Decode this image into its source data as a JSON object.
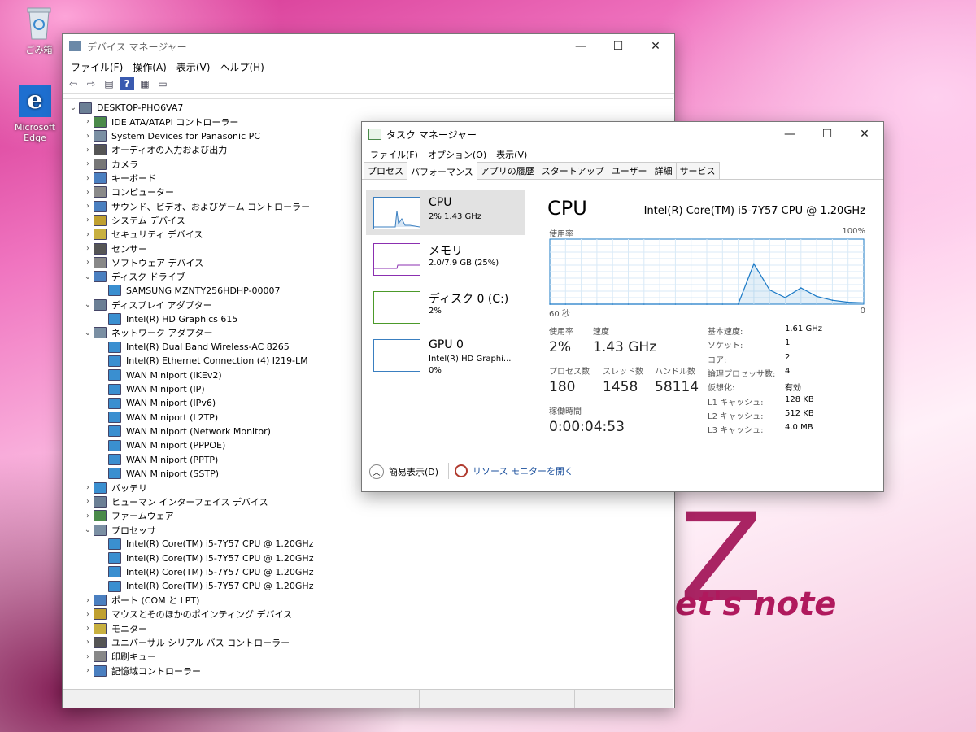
{
  "desktop": {
    "recycle_label": "ごみ箱",
    "edge_label": "Microsoft Edge",
    "brand_text": "et's note"
  },
  "devmgr": {
    "title": "デバイス マネージャー",
    "menu": [
      "ファイル(F)",
      "操作(A)",
      "表示(V)",
      "ヘルプ(H)"
    ],
    "tree": [
      {
        "label": "DESKTOP-PHO6VA7",
        "level": 0,
        "state": "expanded"
      },
      {
        "label": "IDE ATA/ATAPI コントローラー",
        "level": 1,
        "state": "collapsed"
      },
      {
        "label": "System Devices for Panasonic PC",
        "level": 1,
        "state": "collapsed"
      },
      {
        "label": "オーディオの入力および出力",
        "level": 1,
        "state": "collapsed"
      },
      {
        "label": "カメラ",
        "level": 1,
        "state": "collapsed"
      },
      {
        "label": "キーボード",
        "level": 1,
        "state": "collapsed"
      },
      {
        "label": "コンピューター",
        "level": 1,
        "state": "collapsed"
      },
      {
        "label": "サウンド、ビデオ、およびゲーム コントローラー",
        "level": 1,
        "state": "collapsed"
      },
      {
        "label": "システム デバイス",
        "level": 1,
        "state": "collapsed"
      },
      {
        "label": "セキュリティ デバイス",
        "level": 1,
        "state": "collapsed"
      },
      {
        "label": "センサー",
        "level": 1,
        "state": "collapsed"
      },
      {
        "label": "ソフトウェア デバイス",
        "level": 1,
        "state": "collapsed"
      },
      {
        "label": "ディスク ドライブ",
        "level": 1,
        "state": "expanded"
      },
      {
        "label": "SAMSUNG MZNTY256HDHP-00007",
        "level": 2,
        "state": "leaf"
      },
      {
        "label": "ディスプレイ アダプター",
        "level": 1,
        "state": "expanded"
      },
      {
        "label": "Intel(R) HD Graphics 615",
        "level": 2,
        "state": "leaf"
      },
      {
        "label": "ネットワーク アダプター",
        "level": 1,
        "state": "expanded"
      },
      {
        "label": "Intel(R) Dual Band Wireless-AC 8265",
        "level": 2,
        "state": "leaf"
      },
      {
        "label": "Intel(R) Ethernet Connection (4) I219-LM",
        "level": 2,
        "state": "leaf"
      },
      {
        "label": "WAN Miniport (IKEv2)",
        "level": 2,
        "state": "leaf"
      },
      {
        "label": "WAN Miniport (IP)",
        "level": 2,
        "state": "leaf"
      },
      {
        "label": "WAN Miniport (IPv6)",
        "level": 2,
        "state": "leaf"
      },
      {
        "label": "WAN Miniport (L2TP)",
        "level": 2,
        "state": "leaf"
      },
      {
        "label": "WAN Miniport (Network Monitor)",
        "level": 2,
        "state": "leaf"
      },
      {
        "label": "WAN Miniport (PPPOE)",
        "level": 2,
        "state": "leaf"
      },
      {
        "label": "WAN Miniport (PPTP)",
        "level": 2,
        "state": "leaf"
      },
      {
        "label": "WAN Miniport (SSTP)",
        "level": 2,
        "state": "leaf"
      },
      {
        "label": "バッテリ",
        "level": 1,
        "state": "collapsed"
      },
      {
        "label": "ヒューマン インターフェイス デバイス",
        "level": 1,
        "state": "collapsed"
      },
      {
        "label": "ファームウェア",
        "level": 1,
        "state": "collapsed"
      },
      {
        "label": "プロセッサ",
        "level": 1,
        "state": "expanded"
      },
      {
        "label": "Intel(R) Core(TM) i5-7Y57 CPU @ 1.20GHz",
        "level": 2,
        "state": "leaf"
      },
      {
        "label": "Intel(R) Core(TM) i5-7Y57 CPU @ 1.20GHz",
        "level": 2,
        "state": "leaf"
      },
      {
        "label": "Intel(R) Core(TM) i5-7Y57 CPU @ 1.20GHz",
        "level": 2,
        "state": "leaf"
      },
      {
        "label": "Intel(R) Core(TM) i5-7Y57 CPU @ 1.20GHz",
        "level": 2,
        "state": "leaf"
      },
      {
        "label": "ポート (COM と LPT)",
        "level": 1,
        "state": "collapsed"
      },
      {
        "label": "マウスとそのほかのポインティング デバイス",
        "level": 1,
        "state": "collapsed"
      },
      {
        "label": "モニター",
        "level": 1,
        "state": "collapsed"
      },
      {
        "label": "ユニバーサル シリアル バス コントローラー",
        "level": 1,
        "state": "collapsed"
      },
      {
        "label": "印刷キュー",
        "level": 1,
        "state": "collapsed"
      },
      {
        "label": "記憶域コントローラー",
        "level": 1,
        "state": "collapsed"
      }
    ]
  },
  "taskmgr": {
    "title": "タスク マネージャー",
    "menu": [
      "ファイル(F)",
      "オプション(O)",
      "表示(V)"
    ],
    "tabs": [
      "プロセス",
      "パフォーマンス",
      "アプリの履歴",
      "スタートアップ",
      "ユーザー",
      "詳細",
      "サービス"
    ],
    "active_tab": "パフォーマンス",
    "sidebar": [
      {
        "name": "CPU",
        "value": "2%  1.43 GHz"
      },
      {
        "name": "メモリ",
        "value": "2.0/7.9 GB (25%)"
      },
      {
        "name": "ディスク 0 (C:)",
        "value": "2%"
      },
      {
        "name": "GPU 0",
        "value": "Intel(R) HD Graphi...",
        "value2": "0%"
      }
    ],
    "panel": {
      "heading": "CPU",
      "model": "Intel(R) Core(TM) i5-7Y57 CPU @ 1.20GHz",
      "graph_label": "使用率",
      "graph_max": "100%",
      "graph_time": "60 秒",
      "graph_min": "0",
      "usage_label": "使用率",
      "usage": "2%",
      "speed_label": "速度",
      "speed": "1.43 GHz",
      "proc_label": "プロセス数",
      "proc": "180",
      "thread_label": "スレッド数",
      "thread": "1458",
      "handle_label": "ハンドル数",
      "handle": "58114",
      "uptime_label": "稼働時間",
      "uptime": "0:00:04:53",
      "specs": [
        {
          "k": "基本速度:",
          "v": "1.61 GHz"
        },
        {
          "k": "ソケット:",
          "v": "1"
        },
        {
          "k": "コア:",
          "v": "2"
        },
        {
          "k": "論理プロセッサ数:",
          "v": "4"
        },
        {
          "k": "仮想化:",
          "v": "有効"
        },
        {
          "k": "L1 キャッシュ:",
          "v": "128 KB"
        },
        {
          "k": "L2 キャッシュ:",
          "v": "512 KB"
        },
        {
          "k": "L3 キャッシュ:",
          "v": "4.0 MB"
        }
      ]
    },
    "footer": {
      "less_details": "簡易表示(D)",
      "resource_monitor": "リソース モニターを開く"
    }
  },
  "chart_data": {
    "type": "line",
    "title": "",
    "ylabel": "使用率",
    "xlabel": "",
    "ylim": [
      0,
      100
    ],
    "x": [
      60,
      57,
      54,
      51,
      48,
      45,
      42,
      39,
      36,
      33,
      30,
      27,
      24,
      21,
      18,
      15,
      12,
      9,
      6,
      3,
      0
    ],
    "series": [
      {
        "values": [
          2,
          2,
          2,
          2,
          2,
          2,
          2,
          2,
          2,
          2,
          2,
          2,
          2,
          2,
          2,
          2,
          2,
          2,
          2,
          2,
          2
        ]
      },
      {
        "values": [
          0,
          0,
          0,
          0,
          0,
          0,
          0,
          0,
          0,
          0,
          0,
          0,
          0,
          62,
          22,
          10,
          25,
          12,
          6,
          3,
          2
        ]
      }
    ]
  }
}
